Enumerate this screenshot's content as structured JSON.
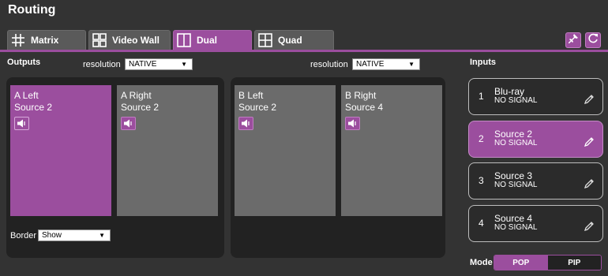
{
  "page": {
    "title": "Routing"
  },
  "tabs": [
    {
      "label": "Matrix",
      "icon": "matrix-grid-icon",
      "active": false
    },
    {
      "label": "Video Wall",
      "icon": "video-wall-icon",
      "active": false
    },
    {
      "label": "Dual",
      "icon": "dual-split-icon",
      "active": true
    },
    {
      "label": "Quad",
      "icon": "quad-grid-icon",
      "active": false
    }
  ],
  "toolbar": {
    "pin_icon": "pin-icon",
    "refresh_icon": "refresh-icon"
  },
  "outputs": {
    "heading": "Outputs",
    "resolution_label_a": "resolution",
    "resolution_value_a": "NATIVE",
    "resolution_label_b": "resolution",
    "resolution_value_b": "NATIVE",
    "border_label": "Border",
    "border_value": "Show",
    "boxes": [
      {
        "name": "A Left",
        "source": "Source 2",
        "selected": true
      },
      {
        "name": "A Right",
        "source": "Source 2",
        "selected": false
      },
      {
        "name": "B Left",
        "source": "Source 2",
        "selected": false
      },
      {
        "name": "B Right",
        "source": "Source 4",
        "selected": false
      }
    ]
  },
  "inputs": {
    "heading": "Inputs",
    "items": [
      {
        "num": "1",
        "name": "Blu-ray",
        "status": "NO SIGNAL",
        "selected": false
      },
      {
        "num": "2",
        "name": "Source 2",
        "status": "NO SIGNAL",
        "selected": true
      },
      {
        "num": "3",
        "name": "Source 3",
        "status": "NO SIGNAL",
        "selected": false
      },
      {
        "num": "4",
        "name": "Source 4",
        "status": "NO SIGNAL",
        "selected": false
      }
    ]
  },
  "mode": {
    "label": "Mode",
    "options": [
      "POP",
      "PIP"
    ],
    "active": "POP"
  },
  "colors": {
    "accent": "#9b4e9e",
    "background": "#333333",
    "panel": "#222222",
    "box": "#6b6b6b"
  }
}
